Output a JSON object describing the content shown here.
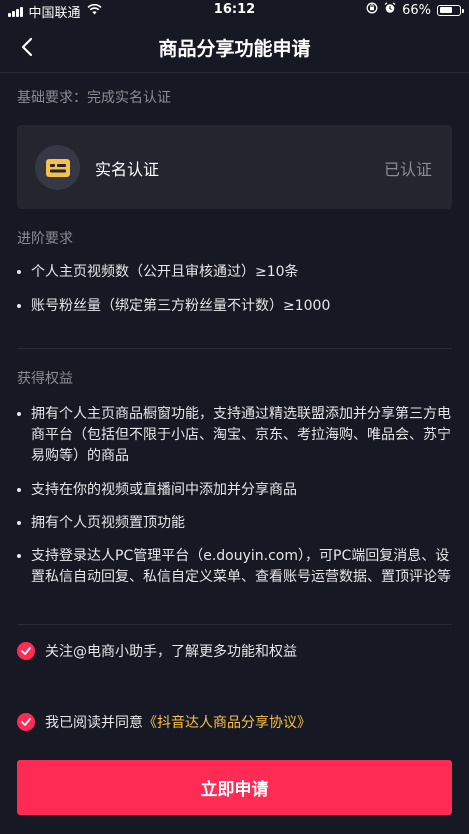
{
  "status_bar": {
    "carrier": "中国联通",
    "time": "16:12",
    "battery_percent": "66%",
    "battery_level": 0.66
  },
  "header": {
    "title": "商品分享功能申请"
  },
  "basic": {
    "title": "基础要求：完成实名认证",
    "card_label": "实名认证",
    "card_status": "已认证"
  },
  "advanced": {
    "title": "进阶要求",
    "items": [
      "个人主页视频数（公开且审核通过）≥10条",
      "账号粉丝量（绑定第三方粉丝量不计数）≥1000"
    ]
  },
  "benefits": {
    "title": "获得权益",
    "items": [
      "拥有个人主页商品橱窗功能，支持通过精选联盟添加并分享第三方电商平台（包括但不限于小店、淘宝、京东、考拉海购、唯品会、苏宁易购等）的商品",
      "支持在你的视频或直播间中添加并分享商品",
      "拥有个人页视频置顶功能",
      "支持登录达人PC管理平台（e.douyin.com），可PC端回复消息、设置私信自动回复、私信自定义菜单、查看账号运营数据、置顶评论等"
    ]
  },
  "follow": {
    "text": "关注@电商小助手，了解更多功能和权益",
    "checked": true
  },
  "agreement": {
    "prefix": "我已阅读并同意",
    "link_text": "《抖音达人商品分享协议》",
    "checked": true
  },
  "apply_button": "立即申请",
  "colors": {
    "background": "#161823",
    "card": "#23252f",
    "accent": "#fe2c55",
    "link": "#f7c04a",
    "muted_text": "#8b8c92"
  }
}
